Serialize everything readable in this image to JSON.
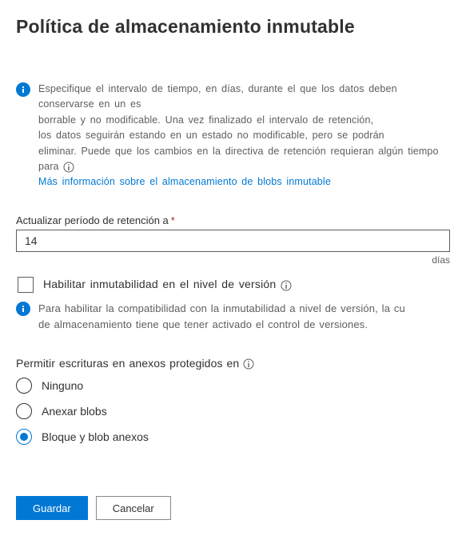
{
  "header": {
    "title": "Política de almacenamiento inmutable"
  },
  "info1": {
    "line1": "Especifique el intervalo de tiempo, en días, durante el que los datos deben conservarse en un es",
    "line2": "borrable y no modificable. Una vez finalizado el intervalo de retención,",
    "line3": "los datos seguirán estando en un estado no modificable, pero se podrán",
    "line4": "eliminar. Puede que los cambios en la directiva de retención requieran algún tiempo para",
    "link": "Más información sobre el almacenamiento de blobs inmutable"
  },
  "retention": {
    "label": "Actualizar período de retención a",
    "value": "14",
    "unit": "días"
  },
  "versioning": {
    "checkbox_label": "Habilitar inmutabilidad en el nivel de versión",
    "info_line1": "Para habilitar la compatibilidad con la inmutabilidad a nivel de versión, la cu",
    "info_line2": "de almacenamiento tiene que tener activado el control de versiones."
  },
  "writes": {
    "group_label": "Permitir escrituras en anexos protegidos en",
    "options": {
      "none": "Ninguno",
      "append": "Anexar blobs",
      "block_append": "Bloque y blob anexos"
    },
    "selected": "block_append"
  },
  "footer": {
    "save": "Guardar",
    "cancel": "Cancelar"
  }
}
